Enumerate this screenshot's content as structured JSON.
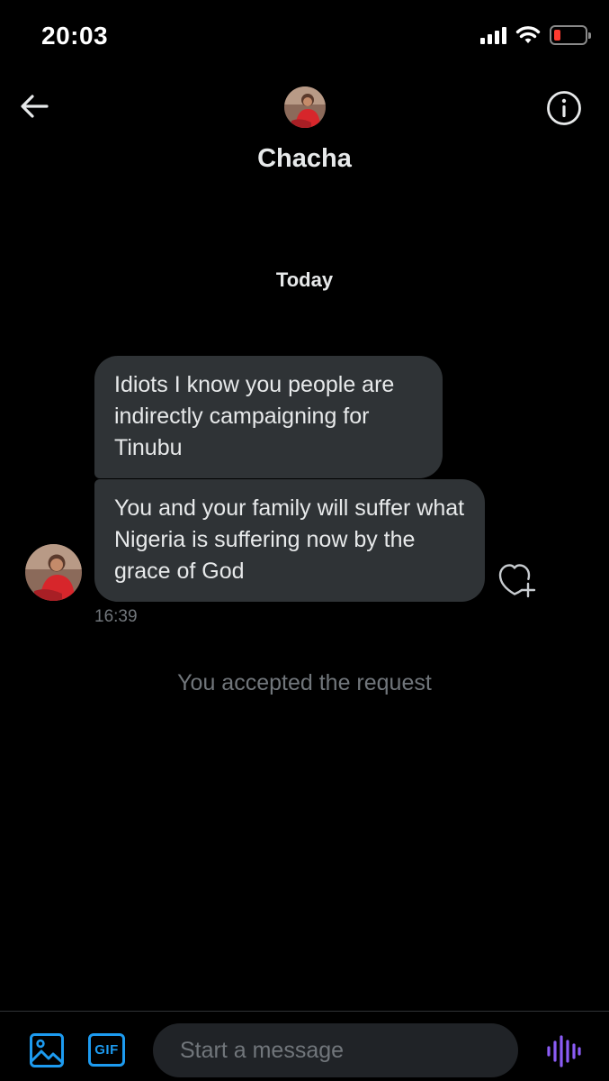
{
  "status_bar": {
    "time": "20:03"
  },
  "header": {
    "name": "Chacha"
  },
  "conversation": {
    "date_separator": "Today",
    "messages": [
      {
        "text": "Idiots I know you people are indirectly campaigning for Tinubu"
      },
      {
        "text": "You and your family will suffer what Nigeria is suffering now by the grace of God"
      }
    ],
    "timestamp": "16:39",
    "system_message": "You accepted the request"
  },
  "composer": {
    "placeholder": "Start a message",
    "gif_label": "GIF"
  },
  "colors": {
    "accent": "#1d9bf0",
    "voice": "#8b5cf6",
    "bubble": "#2f3336",
    "battery_low": "#ff3b30"
  },
  "icons": [
    "signal-icon",
    "wifi-icon",
    "battery-icon",
    "back-arrow-icon",
    "info-icon",
    "heart-plus-icon",
    "image-icon",
    "gif-icon",
    "voice-icon"
  ]
}
